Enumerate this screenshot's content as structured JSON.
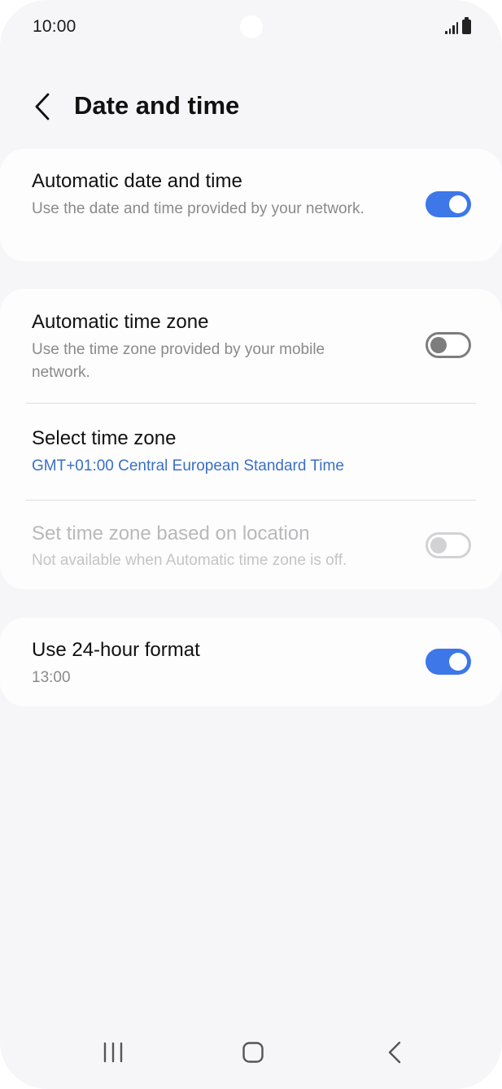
{
  "status_bar": {
    "time": "10:00",
    "icons": [
      "signal-icon",
      "battery-icon"
    ]
  },
  "header": {
    "back_icon": "chevron-left-icon",
    "title": "Date and time"
  },
  "settings": {
    "auto_date_time": {
      "title": "Automatic date and time",
      "subtitle": "Use the date and time provided by your network.",
      "enabled": true
    },
    "auto_time_zone": {
      "title": "Automatic time zone",
      "subtitle": "Use the time zone provided by your mobile network.",
      "enabled": false
    },
    "select_time_zone": {
      "title": "Select time zone",
      "value": "GMT+01:00 Central European Standard Time"
    },
    "location_time_zone": {
      "title": "Set time zone based on location",
      "subtitle": "Not available when Automatic time zone is off.",
      "enabled": false,
      "disabled": true
    },
    "format_24h": {
      "title": "Use 24-hour format",
      "subtitle": "13:00",
      "enabled": true
    }
  },
  "colors": {
    "accent": "#3d77e8",
    "link": "#3a6fc4",
    "background": "#f6f6f8",
    "card": "#fdfdfe"
  },
  "nav_bar": {
    "icons": [
      "recent-apps-icon",
      "home-icon",
      "back-icon"
    ]
  }
}
